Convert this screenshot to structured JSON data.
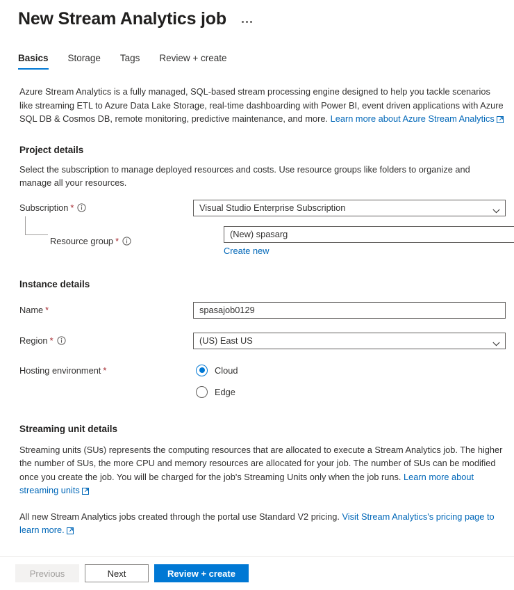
{
  "header": {
    "title": "New Stream Analytics job",
    "more_menu": "more-options"
  },
  "tabs": [
    {
      "label": "Basics",
      "active": true
    },
    {
      "label": "Storage",
      "active": false
    },
    {
      "label": "Tags",
      "active": false
    },
    {
      "label": "Review + create",
      "active": false
    }
  ],
  "intro": {
    "text": "Azure Stream Analytics is a fully managed, SQL-based stream processing engine designed to help you tackle scenarios like streaming ETL to Azure Data Lake Storage, real-time dashboarding with Power BI, event driven applications with Azure SQL DB & Cosmos DB, remote monitoring, predictive maintenance, and more. ",
    "link": "Learn more about Azure Stream Analytics"
  },
  "project_details": {
    "title": "Project details",
    "description": "Select the subscription to manage deployed resources and costs. Use resource groups like folders to organize and manage all your resources.",
    "subscription": {
      "label": "Subscription",
      "required": "*",
      "value": "Visual Studio Enterprise Subscription"
    },
    "resource_group": {
      "label": "Resource group",
      "required": "*",
      "value": "(New) spasarg",
      "create_new_link": "Create new"
    }
  },
  "instance_details": {
    "title": "Instance details",
    "name": {
      "label": "Name",
      "required": "*",
      "value": "spasajob0129"
    },
    "region": {
      "label": "Region",
      "required": "*",
      "value": "(US) East US"
    },
    "hosting_environment": {
      "label": "Hosting environment",
      "required": "*",
      "options": [
        {
          "label": "Cloud",
          "selected": true
        },
        {
          "label": "Edge",
          "selected": false
        }
      ]
    }
  },
  "streaming_unit_details": {
    "title": "Streaming unit details",
    "paragraph1": "Streaming units (SUs) represents the computing resources that are allocated to execute a Stream Analytics job. The higher the number of SUs, the more CPU and memory resources are allocated for your job. The number of SUs can be modified once you create the job. You will be charged for the job's Streaming Units only when the job runs. ",
    "paragraph1_link": "Learn more about streaming units",
    "paragraph2": "All new Stream Analytics jobs created through the portal use Standard V2 pricing. ",
    "paragraph2_link": "Visit Stream Analytics's pricing page to learn more."
  },
  "footer": {
    "previous": "Previous",
    "next": "Next",
    "review_create": "Review + create"
  },
  "colors": {
    "accent": "#0078d4",
    "link": "#0067b8",
    "required": "#a4262c",
    "border": "#605e5c"
  }
}
